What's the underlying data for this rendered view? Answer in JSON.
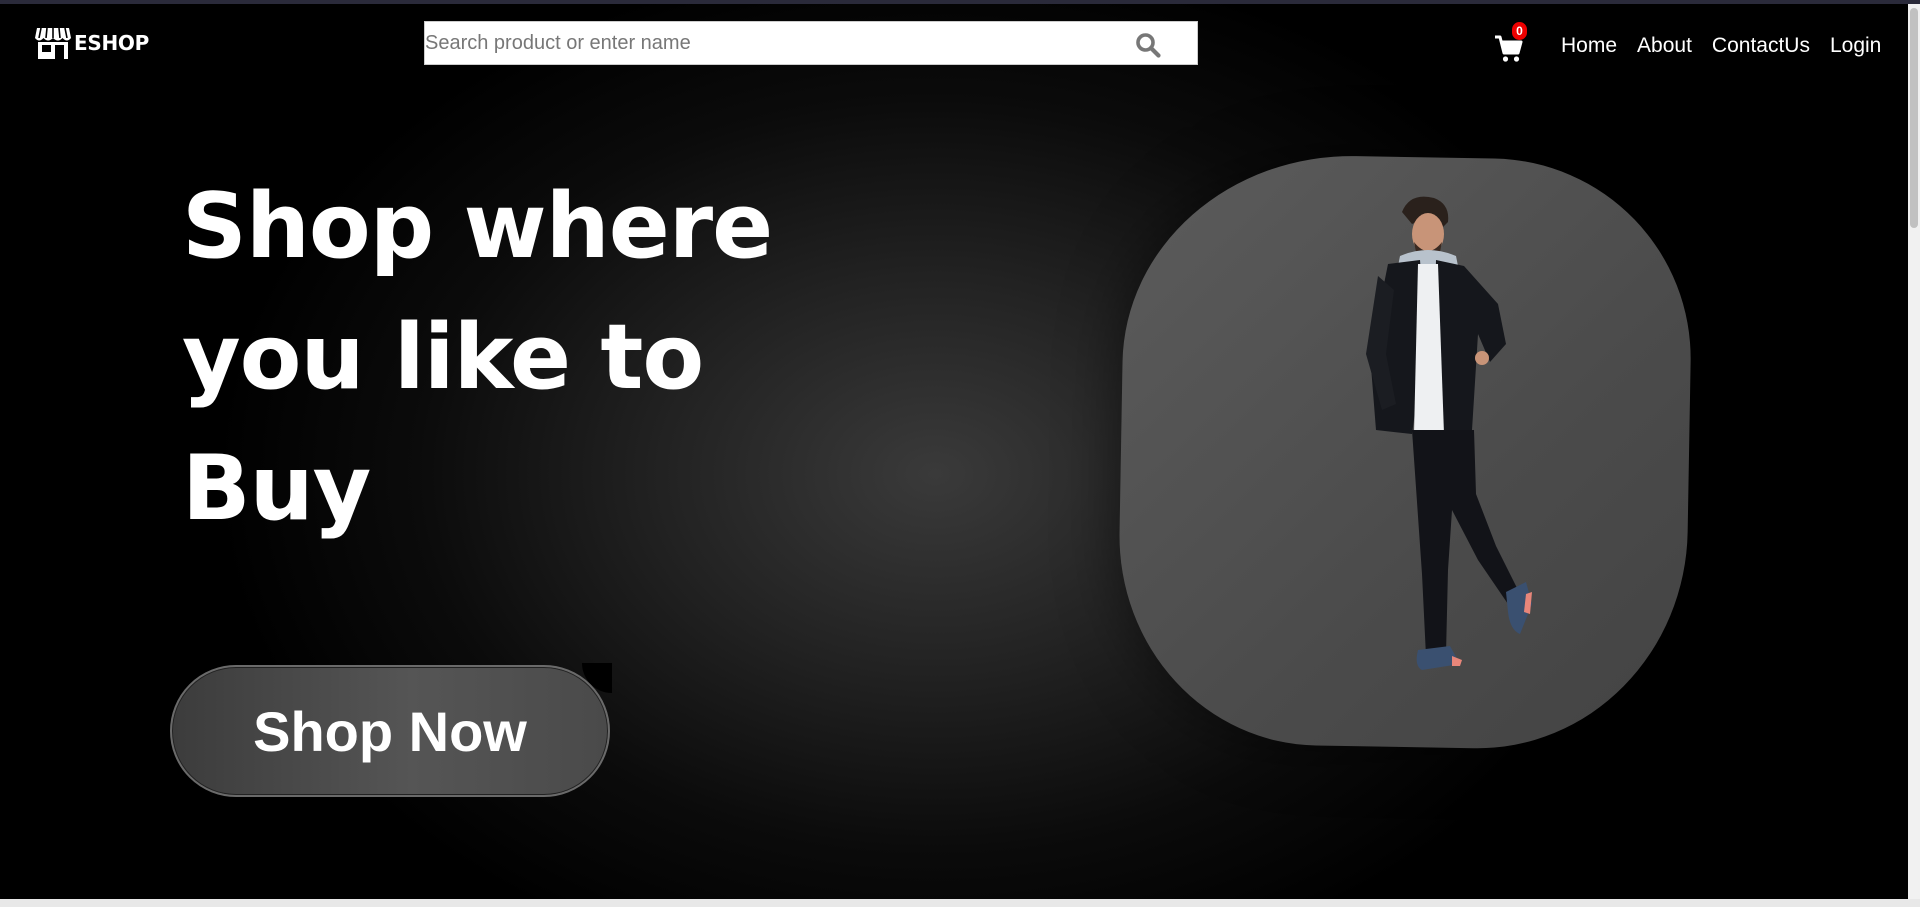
{
  "brand": {
    "name": "ESHOP",
    "icon": "storefront-icon"
  },
  "search": {
    "placeholder": "Search product or enter name",
    "value": "",
    "icon": "search-icon"
  },
  "cart": {
    "icon": "shopping-cart-icon",
    "count": "0",
    "badge_color": "#e00000"
  },
  "nav": {
    "items": [
      {
        "label": "Home"
      },
      {
        "label": "About"
      },
      {
        "label": "ContactUs"
      },
      {
        "label": "Login"
      }
    ]
  },
  "hero": {
    "headline_line1": "Shop where",
    "headline_line2": "you like to",
    "headline_line3": "Buy",
    "cta_label": "Shop Now",
    "image_icon": "fashion-model-photo"
  },
  "colors": {
    "background": "#000000",
    "text": "#ffffff",
    "card": "#555555"
  }
}
